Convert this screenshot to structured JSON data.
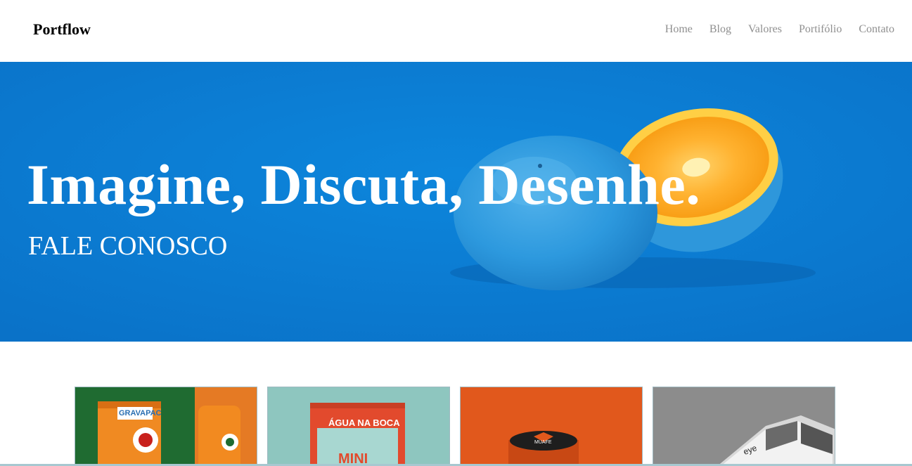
{
  "header": {
    "brand": "Portflow",
    "nav": [
      "Home",
      "Blog",
      "Valores",
      "Portifólio",
      "Contato"
    ]
  },
  "hero": {
    "title": "Imagine, Discuta, Desenhe.",
    "cta": "FALE CONOSCO",
    "background_color": "#0a7bd2"
  },
  "portfolio": {
    "items": [
      {
        "brand_text": "GRAVAPAC",
        "bg": "#1e6a30"
      },
      {
        "brand_text": "ÁGUA NA BOCA",
        "sub_text": "MINI",
        "bg": "#8fc7c0"
      },
      {
        "brand_text": "MUAFE",
        "bg": "#e15b1e"
      },
      {
        "brand_text": "eye",
        "bg": "#8c8c8c"
      }
    ]
  }
}
